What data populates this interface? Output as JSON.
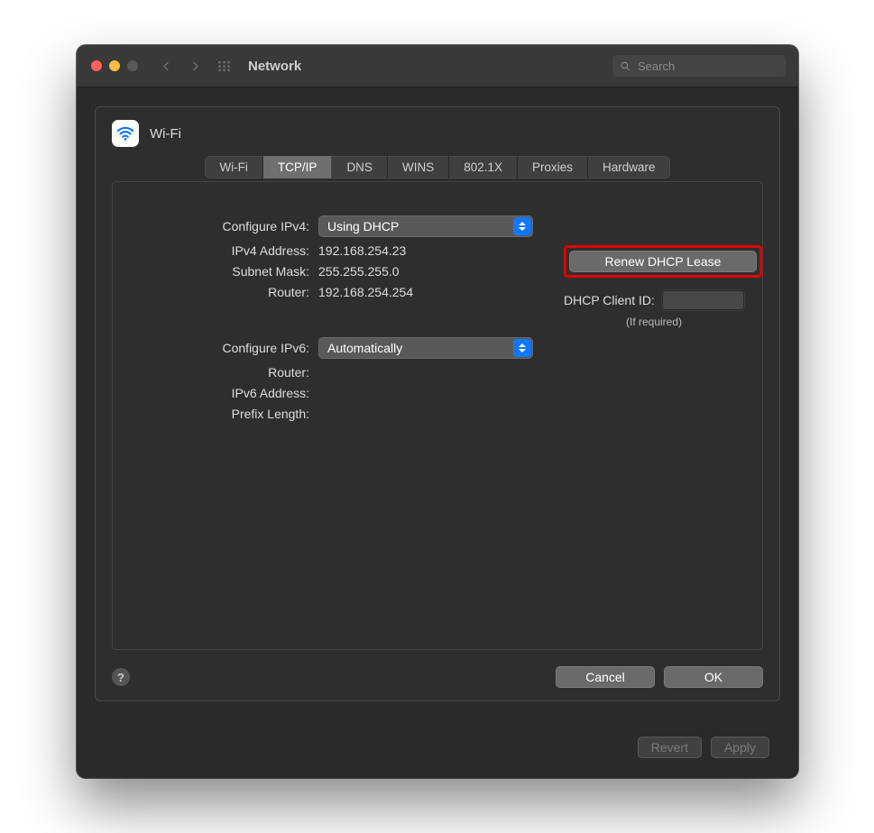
{
  "titlebar": {
    "title": "Network",
    "search_placeholder": "Search"
  },
  "sheet": {
    "title": "Wi-Fi",
    "tabs": [
      "Wi-Fi",
      "TCP/IP",
      "DNS",
      "WINS",
      "802.1X",
      "Proxies",
      "Hardware"
    ],
    "active_tab_index": 1
  },
  "ipv4": {
    "configure_label": "Configure IPv4:",
    "configure_value": "Using DHCP",
    "address_label": "IPv4 Address:",
    "address_value": "192.168.254.23",
    "subnet_label": "Subnet Mask:",
    "subnet_value": "255.255.255.0",
    "router_label": "Router:",
    "router_value": "192.168.254.254"
  },
  "dhcp": {
    "renew_button": "Renew DHCP Lease",
    "client_id_label": "DHCP Client ID:",
    "client_id_value": "",
    "hint": "(If required)"
  },
  "ipv6": {
    "configure_label": "Configure IPv6:",
    "configure_value": "Automatically",
    "router_label": "Router:",
    "router_value": "",
    "address_label": "IPv6 Address:",
    "address_value": "",
    "prefix_label": "Prefix Length:",
    "prefix_value": ""
  },
  "buttons": {
    "help": "?",
    "cancel": "Cancel",
    "ok": "OK",
    "revert": "Revert",
    "apply": "Apply"
  }
}
